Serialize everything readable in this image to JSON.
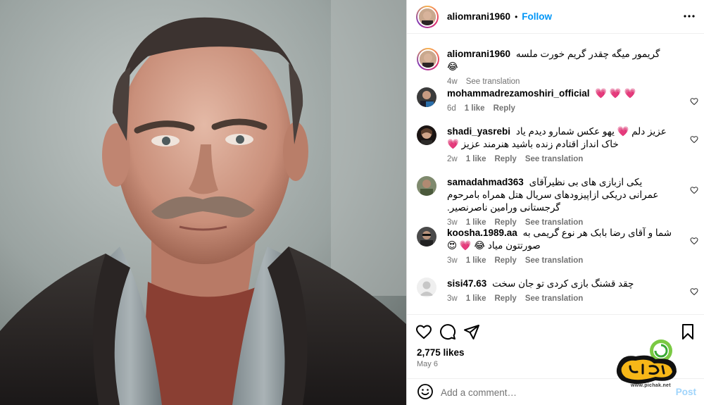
{
  "post": {
    "username": "aliomrani1960",
    "separator": "•",
    "follow_label": "Follow",
    "more_icon": "more-options-icon"
  },
  "caption": {
    "username": "aliomrani1960",
    "text": "گریمور میگه چقدر گریم خورت ملسه 😂",
    "time": "4w",
    "translation_label": "See translation"
  },
  "comments": [
    {
      "username": "mohammadrezamoshiri_official",
      "text": "💗 💗 💗",
      "time": "6d",
      "likes": "1 like",
      "reply": "Reply",
      "translation": ""
    },
    {
      "username": "shadi_yasrebi",
      "text": "عزیز دلم 💗 یهو عکس شمارو دیدم یاد خاک انداز اقتادم زنده باشید هنرمند عزیز 💗",
      "time": "2w",
      "likes": "1 like",
      "reply": "Reply",
      "translation": "See translation"
    },
    {
      "username": "samadahmad363",
      "text": "یکی ازبازی های بی نظیرآقای عمرانی دریکی ازاپیزودهای سریال هتل همراه بامرحوم گرجستانی ورامین ناصرنصیر.",
      "time": "3w",
      "likes": "1 like",
      "reply": "Reply",
      "translation": "See translation"
    },
    {
      "username": "koosha.1989.aa",
      "text": "شما و آقای رضا بابک هر نوع گریمی به صورتتون میاد 😂 💗 😍",
      "time": "3w",
      "likes": "1 like",
      "reply": "Reply",
      "translation": "See translation"
    },
    {
      "username": "sisi47.63",
      "text": "چقد قشنگ بازی کردی تو جان سخت",
      "time": "3w",
      "likes": "1 like",
      "reply": "Reply",
      "translation": "See translation"
    }
  ],
  "actions": {
    "likes": "2,775 likes",
    "date": "May 6",
    "icons": [
      "heart-icon",
      "comment-icon",
      "share-icon",
      "bookmark-icon"
    ]
  },
  "add_comment": {
    "placeholder": "Add a comment…",
    "post_label": "Post"
  },
  "watermark": {
    "url": "www.pichak.net"
  },
  "colors": {
    "accent": "#0095f6",
    "muted": "#737373",
    "heart": "#ff3040",
    "post_disabled": "#9fd4fb"
  }
}
